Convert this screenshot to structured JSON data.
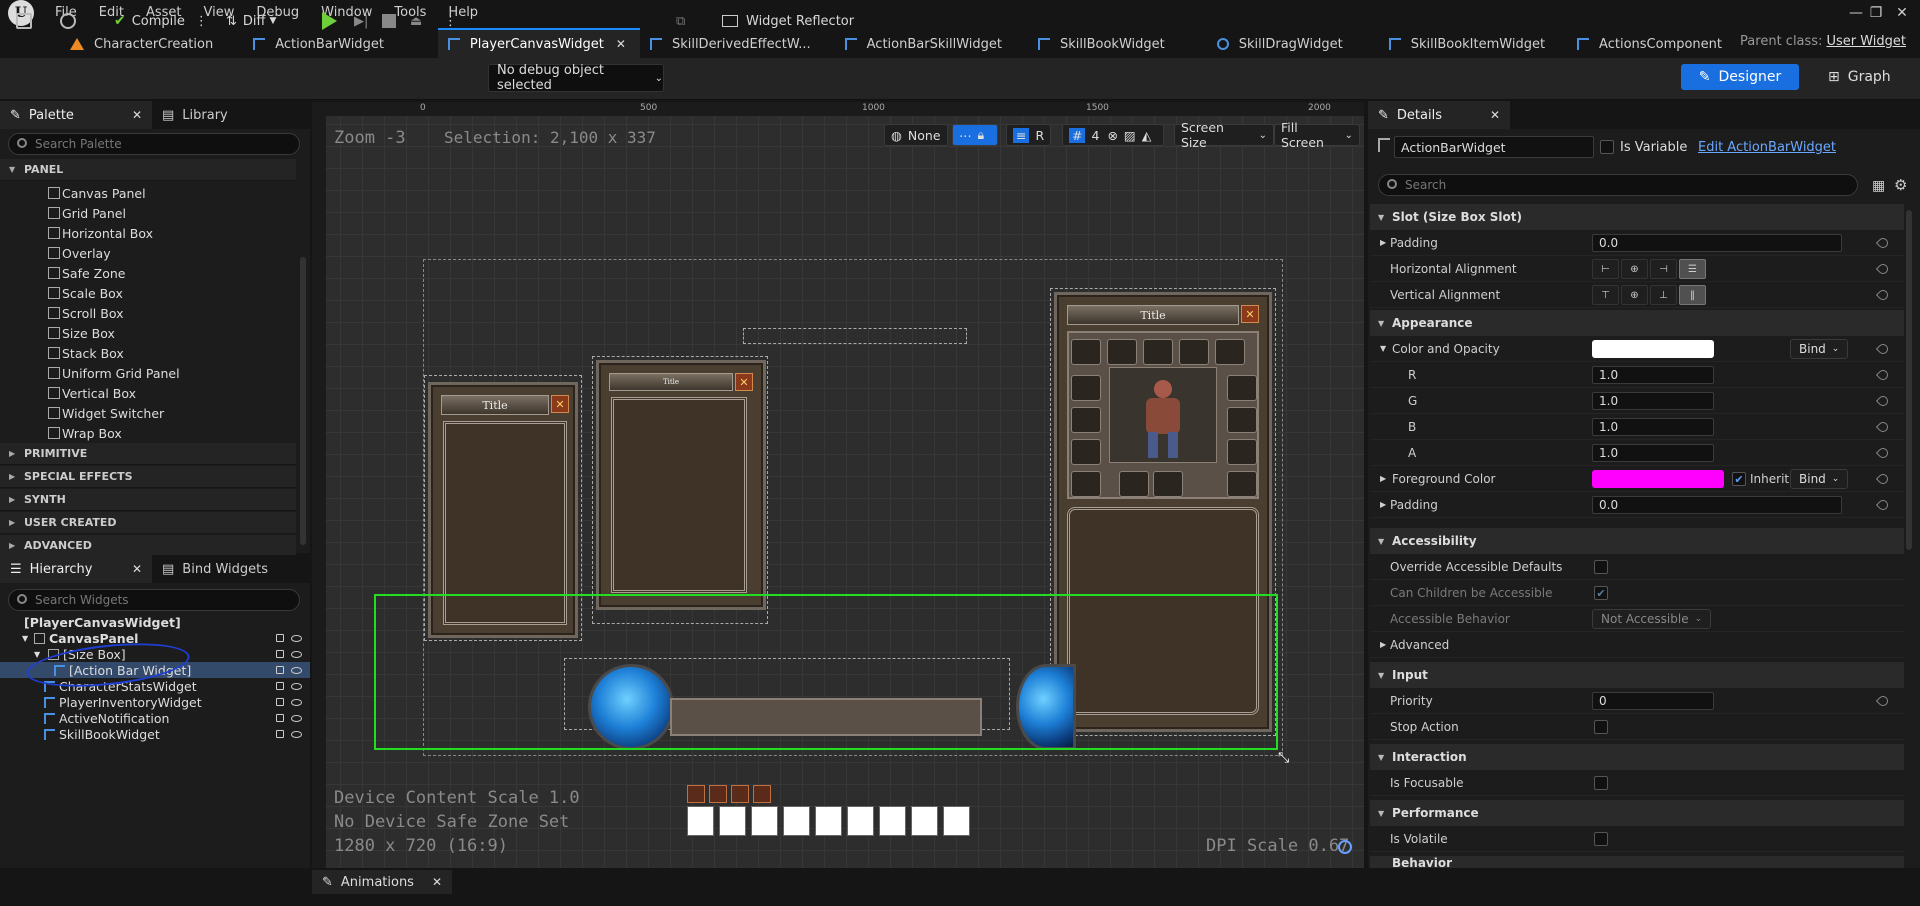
{
  "menu": [
    "File",
    "Edit",
    "Asset",
    "View",
    "Debug",
    "Window",
    "Tools",
    "Help"
  ],
  "tabs": [
    {
      "label": "CharacterCreation",
      "icon": "orange",
      "active": false
    },
    {
      "label": "ActionBarWidget",
      "icon": "widget",
      "active": false
    },
    {
      "label": "PlayerCanvasWidget",
      "icon": "widget",
      "active": true
    },
    {
      "label": "SkillDerivedEffectW...",
      "icon": "widget",
      "active": false
    },
    {
      "label": "ActionBarSkillWidget",
      "icon": "widget",
      "active": false
    },
    {
      "label": "SkillBookWidget",
      "icon": "widget",
      "active": false
    },
    {
      "label": "SkillDragWidget",
      "icon": "circle",
      "active": false
    },
    {
      "label": "SkillBookItemWidget",
      "icon": "widget",
      "active": false
    },
    {
      "label": "ActionsComponent",
      "icon": "widget",
      "active": false
    }
  ],
  "parent_class": {
    "label": "Parent class:",
    "value": "User Widget"
  },
  "toolbar": {
    "compile": "Compile",
    "diff": "Diff",
    "debug_object": "No debug object selected",
    "widget_reflector": "Widget Reflector",
    "designer": "Designer",
    "graph": "Graph"
  },
  "palette": {
    "tab": "Palette",
    "library_tab": "Library",
    "search_placeholder": "Search Palette",
    "panel_category": "PANEL",
    "items": [
      "Canvas Panel",
      "Grid Panel",
      "Horizontal Box",
      "Overlay",
      "Safe Zone",
      "Scale Box",
      "Scroll Box",
      "Size Box",
      "Stack Box",
      "Uniform Grid Panel",
      "Vertical Box",
      "Widget Switcher",
      "Wrap Box"
    ],
    "categories": [
      "PRIMITIVE",
      "SPECIAL EFFECTS",
      "SYNTH",
      "USER CREATED",
      "ADVANCED"
    ]
  },
  "hierarchy": {
    "tab": "Hierarchy",
    "bind_tab": "Bind Widgets",
    "search_placeholder": "Search Widgets",
    "rows": [
      {
        "label": "[PlayerCanvasWidget]"
      },
      {
        "label": "CanvasPanel"
      },
      {
        "label": "[Size Box]"
      },
      {
        "label": "[Action Bar Widget]"
      },
      {
        "label": "CharacterStatsWidget"
      },
      {
        "label": "PlayerInventoryWidget"
      },
      {
        "label": "ActiveNotification"
      },
      {
        "label": "SkillBookWidget"
      }
    ]
  },
  "viewport": {
    "zoom": "Zoom -3",
    "selection": "Selection: 2,100 x 337",
    "none": "None",
    "r": "R",
    "grid_num": "4",
    "screen_size": "Screen Size",
    "fill_screen": "Fill Screen",
    "device_scale": "Device Content Scale 1.0",
    "safe_zone": "No Device Safe Zone Set",
    "resolution": "1280 x 720 (16:9)",
    "dpi": "DPI Scale 0.67",
    "ruler_labels": [
      "0",
      "500",
      "1000",
      "1500",
      "2000"
    ],
    "frame_titles": [
      "Title",
      "Title",
      "Title"
    ]
  },
  "details": {
    "tab": "Details",
    "widget_name": "ActionBarWidget",
    "is_variable": "Is Variable",
    "edit_link": "Edit ActionBarWidget",
    "search_placeholder": "Search",
    "sections": {
      "slot": "Slot (Size Box Slot)",
      "appearance": "Appearance",
      "accessibility": "Accessibility",
      "advanced": "Advanced",
      "input": "Input",
      "interaction": "Interaction",
      "performance": "Performance",
      "behavior": "Behavior"
    },
    "labels": {
      "padding": "Padding",
      "h_align": "Horizontal Alignment",
      "v_align": "Vertical Alignment",
      "color_opacity": "Color and Opacity",
      "r": "R",
      "g": "G",
      "b": "B",
      "a": "A",
      "foreground": "Foreground Color",
      "inherit": "Inherit",
      "bind": "Bind",
      "override": "Override Accessible Defaults",
      "can_children": "Can Children be Accessible",
      "behavior": "Accessible Behavior",
      "priority": "Priority",
      "stop_action": "Stop Action",
      "focusable": "Is Focusable",
      "volatile": "Is Volatile"
    },
    "values": {
      "padding1": "0.0",
      "r": "1.0",
      "g": "1.0",
      "b": "1.0",
      "a": "1.0",
      "padding2": "0.0",
      "accessible_behavior": "Not Accessible",
      "priority": "0"
    },
    "colors": {
      "color_opacity": "#ffffff",
      "foreground": "#ff00ff"
    }
  },
  "animations_tab": "Animations"
}
